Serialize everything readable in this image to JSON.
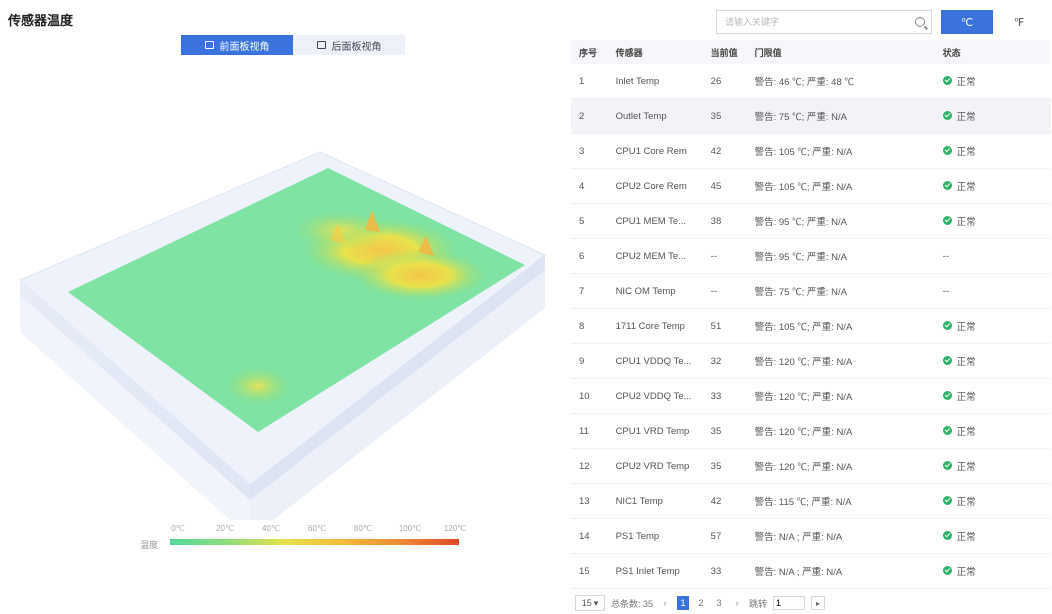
{
  "page": {
    "title": "传感器温度"
  },
  "view_toggle": {
    "front_label": "前面板视角",
    "back_label": "后面板视角",
    "front_icon": "front-panel-icon",
    "back_icon": "back-panel-icon"
  },
  "search": {
    "placeholder": "请输入关键字"
  },
  "units": {
    "celsius": "℃",
    "fahrenheit": "℉"
  },
  "legend": {
    "label": "温度",
    "ticks": [
      "0℃",
      "20℃",
      "40℃",
      "60℃",
      "80℃",
      "100℃",
      "120℃"
    ],
    "colors": [
      "#52d99a",
      "#8fdd7c",
      "#e9e24b",
      "#f2b93a",
      "#ee8a35",
      "#e04a2a"
    ]
  },
  "table": {
    "headers": {
      "index": "序号",
      "name": "传感器",
      "value": "当前值",
      "threshold": "门限值",
      "status": "状态"
    },
    "rows": [
      {
        "index": "1",
        "name": "Inlet Temp",
        "value": "26",
        "threshold": "警告: 46 ℃; 严重: 48 ℃",
        "status": "正常"
      },
      {
        "index": "2",
        "name": "Outlet Temp",
        "value": "35",
        "threshold": "警告: 75 ℃; 严重: N/A",
        "status": "正常"
      },
      {
        "index": "3",
        "name": "CPU1 Core Rem",
        "value": "42",
        "threshold": "警告: 105 ℃; 严重: N/A",
        "status": "正常"
      },
      {
        "index": "4",
        "name": "CPU2 Core Rem",
        "value": "45",
        "threshold": "警告: 105 ℃; 严重: N/A",
        "status": "正常"
      },
      {
        "index": "5",
        "name": "CPU1 MEM Te...",
        "value": "38",
        "threshold": "警告: 95 ℃; 严重: N/A",
        "status": "正常"
      },
      {
        "index": "6",
        "name": "CPU2 MEM Te...",
        "value": "--",
        "threshold": "警告: 95 ℃; 严重: N/A",
        "status": "--"
      },
      {
        "index": "7",
        "name": "NIC OM Temp",
        "value": "--",
        "threshold": "警告: 75 ℃; 严重: N/A",
        "status": "--"
      },
      {
        "index": "8",
        "name": "1711 Core Temp",
        "value": "51",
        "threshold": "警告: 105 ℃; 严重: N/A",
        "status": "正常"
      },
      {
        "index": "9",
        "name": "CPU1 VDDQ Te...",
        "value": "32",
        "threshold": "警告: 120 ℃; 严重: N/A",
        "status": "正常"
      },
      {
        "index": "10",
        "name": "CPU2 VDDQ Te...",
        "value": "33",
        "threshold": "警告: 120 ℃; 严重: N/A",
        "status": "正常"
      },
      {
        "index": "11",
        "name": "CPU1 VRD Temp",
        "value": "35",
        "threshold": "警告: 120 ℃; 严重: N/A",
        "status": "正常"
      },
      {
        "index": "12",
        "name": "CPU2 VRD Temp",
        "value": "35",
        "threshold": "警告: 120 ℃; 严重: N/A",
        "status": "正常"
      },
      {
        "index": "13",
        "name": "NIC1 Temp",
        "value": "42",
        "threshold": "警告: 115 ℃; 严重: N/A",
        "status": "正常"
      },
      {
        "index": "14",
        "name": "PS1 Temp",
        "value": "57",
        "threshold": "警告: N/A ; 严重: N/A",
        "status": "正常"
      },
      {
        "index": "15",
        "name": "PS1 Inlet Temp",
        "value": "33",
        "threshold": "警告: N/A ; 严重: N/A",
        "status": "正常"
      }
    ],
    "selected_row": "2"
  },
  "pagination": {
    "page_size": "15",
    "total": "总条数: 35",
    "pages": [
      "1",
      "2",
      "3"
    ],
    "current_page": "1",
    "goto_label": "跳转",
    "goto_value": "1",
    "prev_icon": "chevron-left-icon",
    "next_icon": "chevron-right-icon"
  },
  "colors": {
    "accent": "#3a73db",
    "ok": "#2fb36a"
  }
}
